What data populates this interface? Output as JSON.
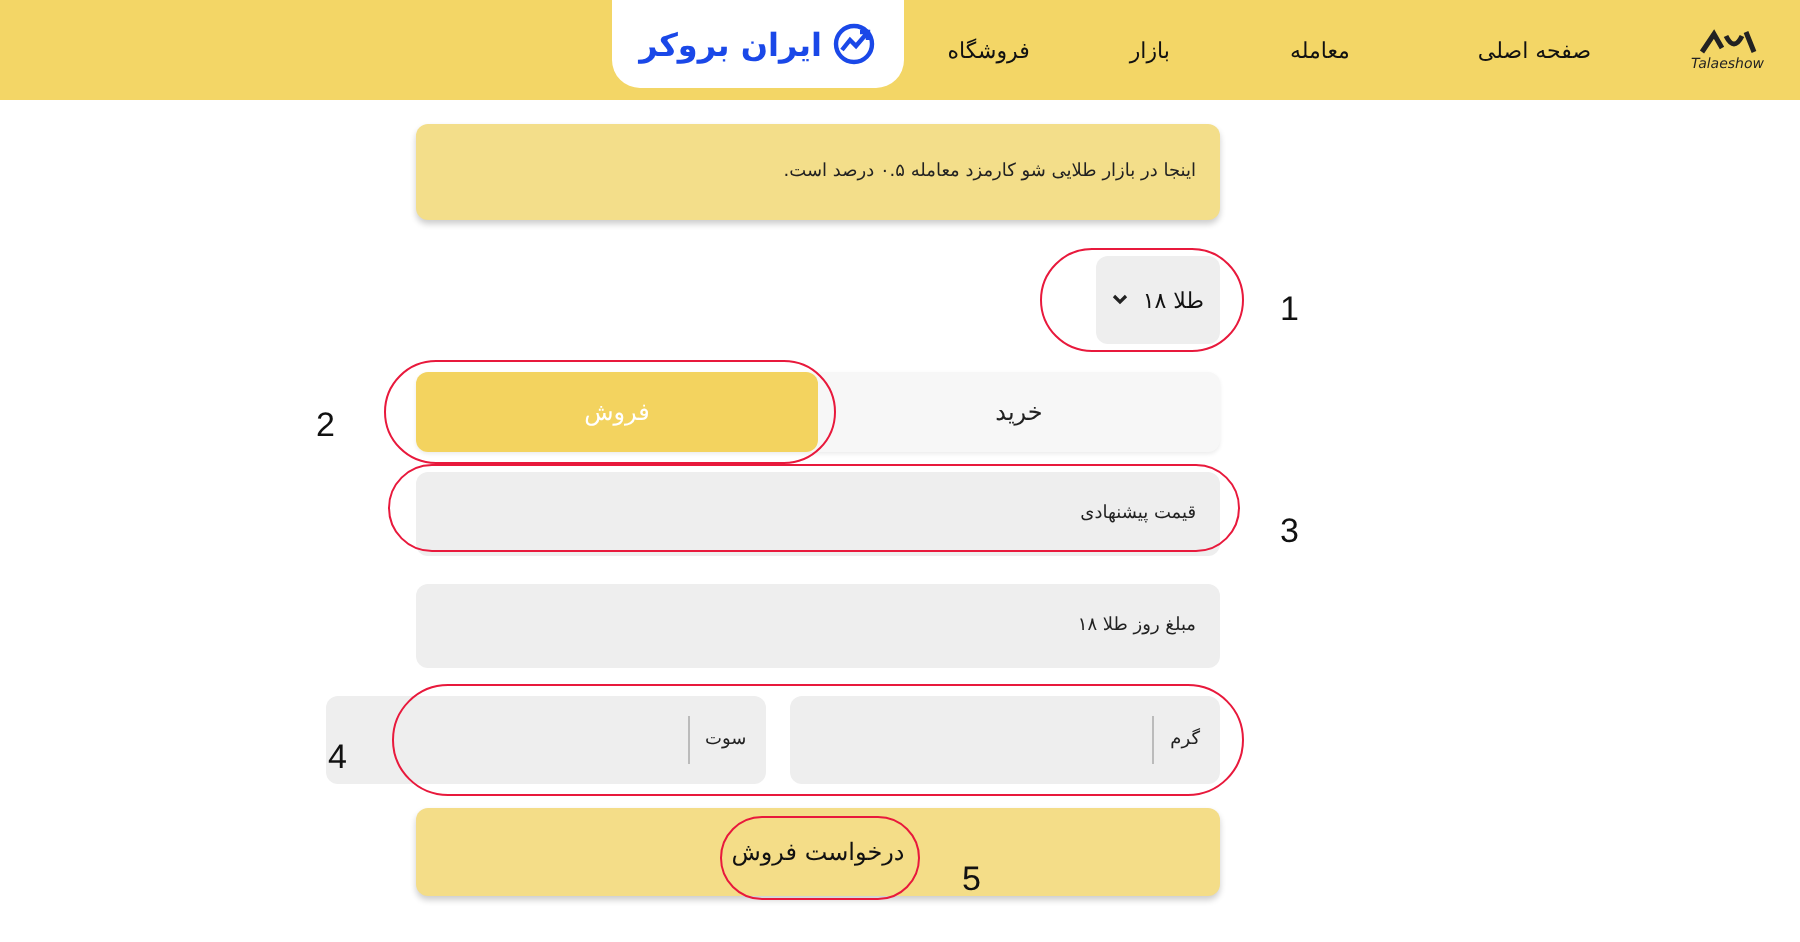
{
  "header": {
    "logo_caption": "Talaeshow",
    "nav": [
      "صفحه اصلی",
      "معامله",
      "بازار",
      "فروشگاه"
    ],
    "partner": "ایران بروکر"
  },
  "notice": "اینجا در بازار طلایی شو کارمزد معامله ۰.۵ درصد است.",
  "asset_select": {
    "value": "طلا ۱۸"
  },
  "tabs": [
    {
      "label": "خرید",
      "selected": false
    },
    {
      "label": "فروش",
      "selected": true
    }
  ],
  "offer_price": {
    "placeholder": "قیمت پیشنهادی"
  },
  "daily_price": {
    "placeholder": "مبلغ روز طلا ۱۸"
  },
  "amounts": [
    {
      "unit": "گرم"
    },
    {
      "unit": "سوت"
    }
  ],
  "submit": "درخواست فروش",
  "annotations": [
    "1",
    "2",
    "3",
    "4",
    "5"
  ]
}
